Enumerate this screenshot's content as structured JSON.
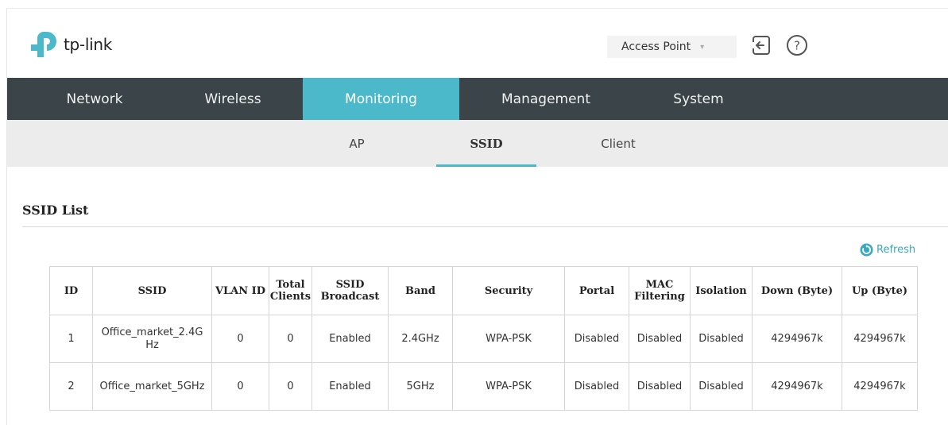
{
  "header": {
    "brand": "tp-link",
    "mode_select": {
      "value": "Access Point",
      "caret": "▾"
    }
  },
  "icons": {
    "logout": "logout-icon",
    "help": "help-icon",
    "help_glyph": "?",
    "refresh": "refresh-icon"
  },
  "colors": {
    "accent": "#4bb9ca",
    "nav_bg": "#3a4449",
    "subnav_bg": "#ececec",
    "link": "#3aa8c0"
  },
  "main_nav": {
    "items": [
      {
        "label": "Network"
      },
      {
        "label": "Wireless"
      },
      {
        "label": "Monitoring",
        "active": true
      },
      {
        "label": "Management"
      },
      {
        "label": "System"
      }
    ]
  },
  "sub_nav": {
    "items": [
      {
        "label": "AP"
      },
      {
        "label": "SSID",
        "active": true
      },
      {
        "label": "Client"
      }
    ]
  },
  "section": {
    "title": "SSID List",
    "refresh_label": "Refresh"
  },
  "table": {
    "headers": [
      "ID",
      "SSID",
      "VLAN ID",
      "Total\nClients",
      "SSID\nBroadcast",
      "Band",
      "Security",
      "Portal",
      "MAC\nFiltering",
      "Isolation",
      "Down (Byte)",
      "Up (Byte)"
    ],
    "rows": [
      [
        "1",
        "Office_market_2.4G\nHz",
        "0",
        "0",
        "Enabled",
        "2.4GHz",
        "WPA-PSK",
        "Disabled",
        "Disabled",
        "Disabled",
        "4294967k",
        "4294967k"
      ],
      [
        "2",
        "Office_market_5GHz",
        "0",
        "0",
        "Enabled",
        "5GHz",
        "WPA-PSK",
        "Disabled",
        "Disabled",
        "Disabled",
        "4294967k",
        "4294967k"
      ]
    ]
  }
}
